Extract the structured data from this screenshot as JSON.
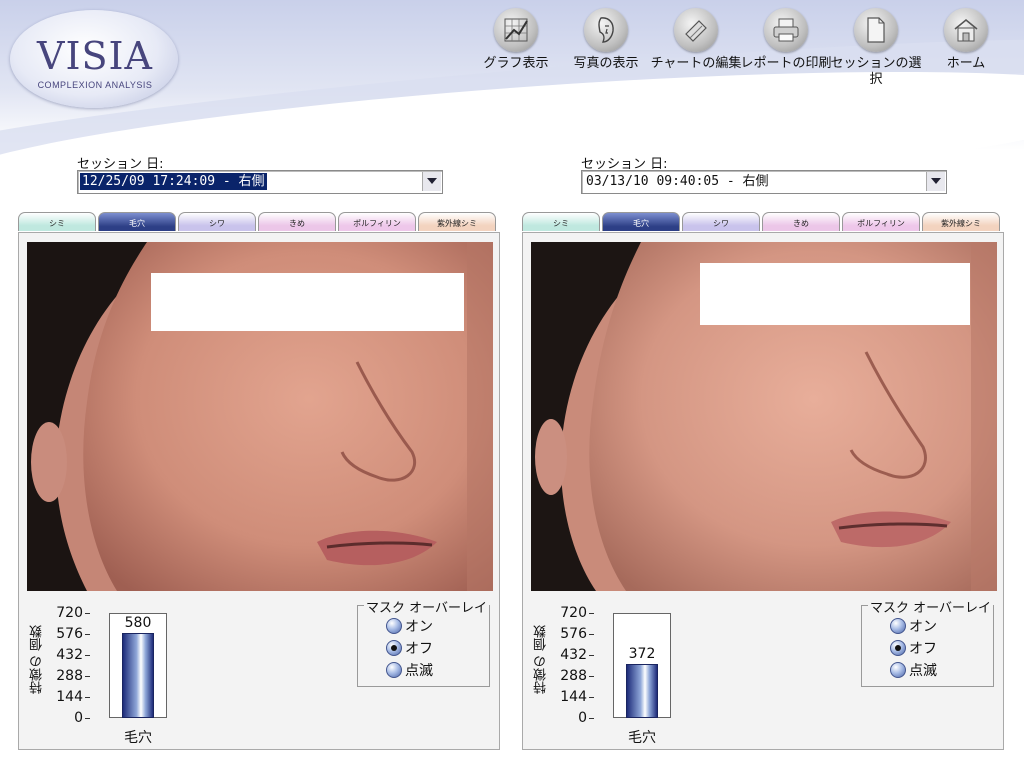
{
  "app": {
    "logo_word": "VISIA",
    "logo_sub": "COMPLEXION ANALYSIS"
  },
  "toolbar": [
    {
      "label": "グラフ表示",
      "icon": "graph-icon"
    },
    {
      "label": "写真の表示",
      "icon": "face-icon"
    },
    {
      "label": "チャートの編集",
      "icon": "edit-chart-icon"
    },
    {
      "label": "レポートの印刷",
      "icon": "printer-icon"
    },
    {
      "label": "セッションの選択",
      "icon": "document-icon"
    },
    {
      "label": "ホーム",
      "icon": "home-icon"
    }
  ],
  "tab_labels": [
    "シミ",
    "毛穴",
    "シワ",
    "きめ",
    "ポルフィリン",
    "紫外線シミ"
  ],
  "tab_colors": [
    "#bfe8df",
    "#2d3f86",
    "#c9c3ec",
    "#ecc6e8",
    "#eec7ea",
    "#f3d3bf"
  ],
  "active_tab_index": 1,
  "left": {
    "session_label": "セッション 日:",
    "session_value": "12/25/09 17:24:09 - 右側",
    "chart": {
      "y_label": "特徴の 個数",
      "ticks": [
        "720",
        "576",
        "432",
        "288",
        "144",
        "0"
      ],
      "category": "毛穴",
      "value_label": "580"
    },
    "overlay": {
      "title": "マスク オーバーレイ",
      "options": [
        "オン",
        "オフ",
        "点滅"
      ],
      "selected": 1
    }
  },
  "right": {
    "session_label": "セッション 日:",
    "session_value": "03/13/10 09:40:05 - 右側",
    "chart": {
      "y_label": "特徴の 個数",
      "ticks": [
        "720",
        "576",
        "432",
        "288",
        "144",
        "0"
      ],
      "category": "毛穴",
      "value_label": "372"
    },
    "overlay": {
      "title": "マスク オーバーレイ",
      "options": [
        "オン",
        "オフ",
        "点滅"
      ],
      "selected": 1
    }
  },
  "chart_data": [
    {
      "type": "bar",
      "categories": [
        "毛穴"
      ],
      "values": [
        580
      ],
      "ylabel": "特徴の 個数",
      "ylim": [
        0,
        720
      ]
    },
    {
      "type": "bar",
      "categories": [
        "毛穴"
      ],
      "values": [
        372
      ],
      "ylabel": "特徴の 個数",
      "ylim": [
        0,
        720
      ]
    }
  ]
}
